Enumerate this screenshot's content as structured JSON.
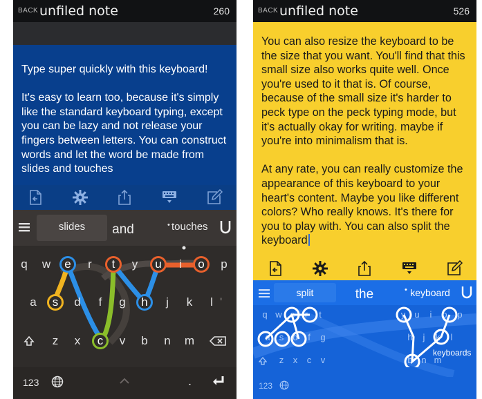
{
  "left": {
    "topbar": {
      "back": "BACK",
      "title": "unfiled note",
      "count": "260"
    },
    "note": {
      "paragraphs": [
        "Type super quickly with this keyboard!",
        "It's easy to learn too, because it's simply like the standard keyboard typing, except you can be lazy and not release your fingers between letters. You can construct words and let the word be made from slides and touches"
      ]
    },
    "toolbar": [
      "note-back-icon",
      "gear-icon",
      "share-icon",
      "keyboard-icon",
      "compose-icon"
    ],
    "keyboard": {
      "suggestions": [
        "slides",
        "and",
        "touches"
      ],
      "row1": [
        "q",
        "w",
        "e",
        "r",
        "t",
        "y",
        "u",
        "i",
        "o",
        "p"
      ],
      "row2": [
        "a",
        "s",
        "d",
        "f",
        "g",
        "h",
        "j",
        "k",
        "l"
      ],
      "row3": [
        "z",
        "x",
        "c",
        "v",
        "b",
        "n",
        "m"
      ],
      "mode_key": "123",
      "dot_key": ".",
      "colors": {
        "blue": "#2c8fe6",
        "orange": "#e8602c",
        "yellow": "#f0b320",
        "green": "#8bbd2a"
      }
    }
  },
  "right": {
    "topbar": {
      "back": "BACK",
      "title": "unfiled note",
      "count": "526"
    },
    "note": {
      "paragraphs": [
        "You can also resize the keyboard to be the size that you want. You'll find that this small size also works quite well. Once you're used to it that is. Of course, because of the small size it's harder to peck type on the peck typing mode, but it's actually okay for writing. maybe if you're into minimalism that is.",
        "At any rate, you can really customize the appearance of this keyboard to your heart's content. Maybe you like different colors? Who really knows. It's there for you to play with. You can also split the keyboard"
      ]
    },
    "toolbar": [
      "note-back-icon",
      "gear-icon",
      "share-icon",
      "keyboard-icon",
      "compose-icon"
    ],
    "keyboard": {
      "suggestions": [
        "split",
        "the",
        "keyboard"
      ],
      "ghost_word": "keyboards",
      "left_row1": [
        "q",
        "w",
        "e",
        "r",
        "t"
      ],
      "left_row2": [
        "a",
        "s",
        "d",
        "f",
        "g"
      ],
      "left_row3": [
        "z",
        "x",
        "c",
        "v"
      ],
      "right_row1": [
        "y",
        "u",
        "i",
        "o",
        "p"
      ],
      "right_row2": [
        "h",
        "j",
        "k",
        "l"
      ],
      "right_row3": [
        "b",
        "n",
        "m"
      ],
      "mode_key": "123"
    }
  }
}
